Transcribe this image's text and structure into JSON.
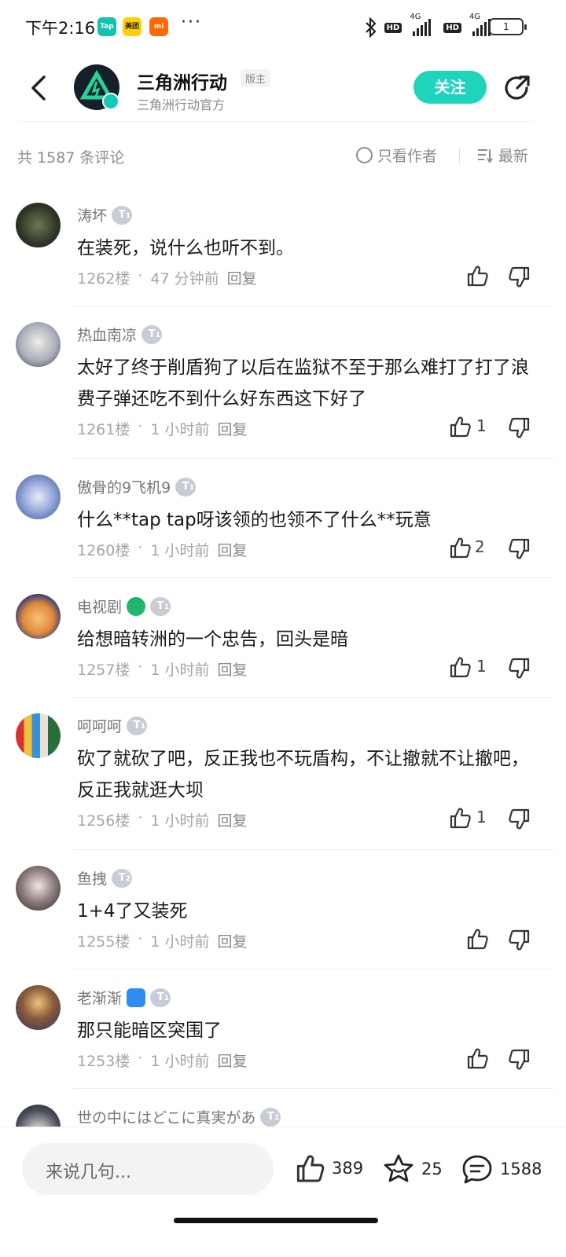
{
  "status_bar": {
    "time": "下午2:16",
    "apps": [
      "Tap",
      "美团",
      "mi"
    ],
    "more": "···",
    "network": "4G",
    "hd": "HD",
    "battery": "1"
  },
  "header": {
    "forum_name": "三角洲行动",
    "owner_tag": "版主",
    "subtitle": "三角洲行动官方",
    "follow_label": "关注",
    "accent_color": "#1ed4bd"
  },
  "filter": {
    "count_text": "共 1587 条评论",
    "only_author_label": "只看作者",
    "sort_label": "最新"
  },
  "comments": [
    {
      "user": "涛坏",
      "level": "1",
      "text": "在装死，说什么也听不到。",
      "floor": "1262楼",
      "time": "47 分钟前",
      "reply": "回复",
      "likes": ""
    },
    {
      "user": "热血南凉",
      "level": "1",
      "text": "太好了终于削盾狗了以后在监狱不至于那么难打了打了浪费子弹还吃不到什么好东西这下好了",
      "floor": "1261楼",
      "time": "1 小时前",
      "reply": "回复",
      "likes": "1"
    },
    {
      "user": "傲骨的9飞机9",
      "level": "1",
      "text": "什么**tap tap呀该领的也领不了什么**玩意",
      "floor": "1260楼",
      "time": "1 小时前",
      "reply": "回复",
      "likes": "2"
    },
    {
      "user": "电视剧",
      "level": "1",
      "text": "给想暗转洲的一个忠告，回头是暗",
      "floor": "1257楼",
      "time": "1 小时前",
      "reply": "回复",
      "likes": "1"
    },
    {
      "user": "呵呵呵",
      "level": "1",
      "text": "砍了就砍了吧，反正我也不玩盾构，不让撤就不让撤吧，反正我就逛大坝",
      "floor": "1256楼",
      "time": "1 小时前",
      "reply": "回复",
      "likes": "1"
    },
    {
      "user": "鱼拽",
      "level": "2",
      "text": "1+4了又装死",
      "floor": "1255楼",
      "time": "1 小时前",
      "reply": "回复",
      "likes": ""
    },
    {
      "user": "老渐渐",
      "level": "1",
      "text": "那只能暗区突围了",
      "floor": "1253楼",
      "time": "1 小时前",
      "reply": "回复",
      "likes": ""
    },
    {
      "user": "世の中にはどこに真実があ",
      "level": "1",
      "text": "",
      "floor": "",
      "time": "",
      "reply": "",
      "likes": ""
    }
  ],
  "bottom_bar": {
    "input_placeholder": "来说几句...",
    "likes": "389",
    "favorites": "25",
    "comments": "1588"
  }
}
